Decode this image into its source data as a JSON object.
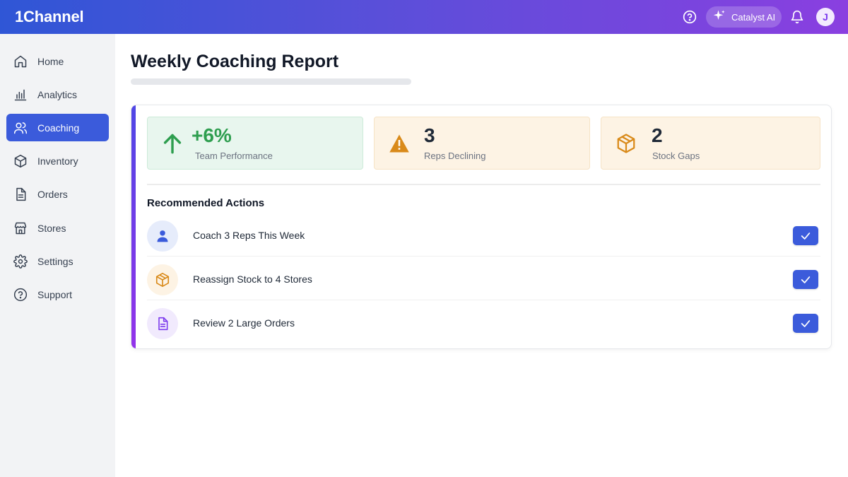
{
  "header": {
    "app_name": "1Channel",
    "catalyst_label": "Catalyst AI",
    "avatar_initial": "J",
    "icons": [
      "help-icon",
      "sparkle-icon",
      "bell-icon"
    ]
  },
  "sidebar": {
    "items": [
      {
        "label": "Home",
        "icon": "home-icon",
        "active": false
      },
      {
        "label": "Analytics",
        "icon": "bar-chart-icon",
        "active": false
      },
      {
        "label": "Coaching",
        "icon": "users-icon",
        "active": true
      },
      {
        "label": "Inventory",
        "icon": "box-icon",
        "active": false
      },
      {
        "label": "Orders",
        "icon": "document-icon",
        "active": false
      },
      {
        "label": "Stores",
        "icon": "store-icon",
        "active": false
      },
      {
        "label": "Settings",
        "icon": "gear-icon",
        "active": false
      },
      {
        "label": "Support",
        "icon": "help-icon",
        "active": false
      }
    ]
  },
  "main": {
    "title": "Weekly Coaching Report",
    "stats": [
      {
        "value": "+6%",
        "label": "Team Performance",
        "icon": "arrow-up-icon",
        "color": "#2e9e4f"
      },
      {
        "value": "3",
        "label": "Reps Declining",
        "icon": "warning-icon",
        "color": "#d98a1a"
      },
      {
        "value": "2",
        "label": "Stock Gaps",
        "icon": "box-icon",
        "color": "#d98a1a"
      }
    ],
    "recommended_title": "Recommended Actions",
    "actions": [
      {
        "label": "Coach 3 Reps This Week",
        "icon": "person-icon"
      },
      {
        "label": "Reassign Stock to 4 Stores",
        "icon": "box-icon"
      },
      {
        "label": "Review 2 Large Orders",
        "icon": "document-icon"
      }
    ]
  },
  "colors": {
    "accent": "#3b5bdb",
    "header_gradient_start": "#2f56d6",
    "header_gradient_end": "#8a3fe0",
    "positive": "#2e9e4f",
    "warning": "#d98a1a"
  }
}
